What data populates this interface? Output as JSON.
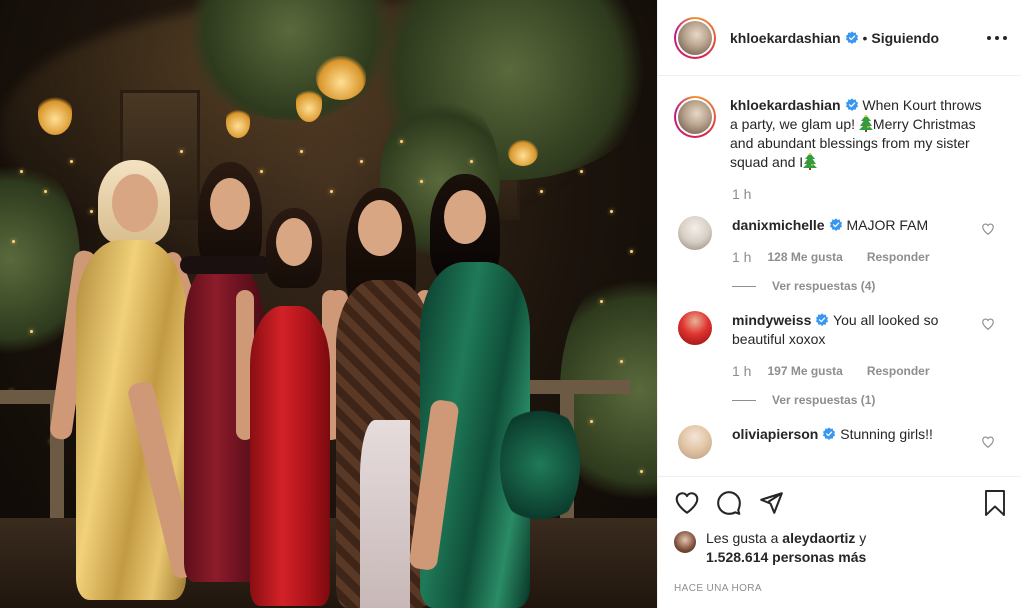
{
  "header": {
    "username": "khloekardashian",
    "separator": "•",
    "follow_status": "Siguiendo"
  },
  "caption": {
    "username": "khloekardashian",
    "text_part1": "When Kourt throws a party, we glam up! ",
    "text_part2": "Merry Christmas and abundant blessings from my sister squad and I",
    "time": "1 h"
  },
  "comments": [
    {
      "username": "danixmichelle",
      "text": "MAJOR FAM",
      "time": "1 h",
      "likes": "128 Me gusta",
      "reply": "Responder",
      "view_replies": "Ver respuestas (4)"
    },
    {
      "username": "mindyweiss",
      "text": "You all looked so beautiful xoxox",
      "time": "1 h",
      "likes": "197 Me gusta",
      "reply": "Responder",
      "view_replies": "Ver respuestas (1)"
    },
    {
      "username": "oliviapierson",
      "text": "Stunning girls!!"
    }
  ],
  "likes": {
    "prefix": "Les gusta a ",
    "user": "aleydaortiz",
    "conjunction": " y",
    "count": "1.528.614 personas más"
  },
  "post_time": "HACE UNA HORA",
  "icons": {
    "verified": "verified-badge-icon",
    "more": "more-options-icon",
    "like": "heart-icon",
    "comment": "comment-bubble-icon",
    "share": "paper-plane-icon",
    "save": "bookmark-icon",
    "emoji": "christmas-tree-emoji"
  },
  "colors": {
    "verified_blue": "#3897f0",
    "text_primary": "#262626",
    "text_secondary": "#8e8e8e",
    "border": "#efefef"
  }
}
